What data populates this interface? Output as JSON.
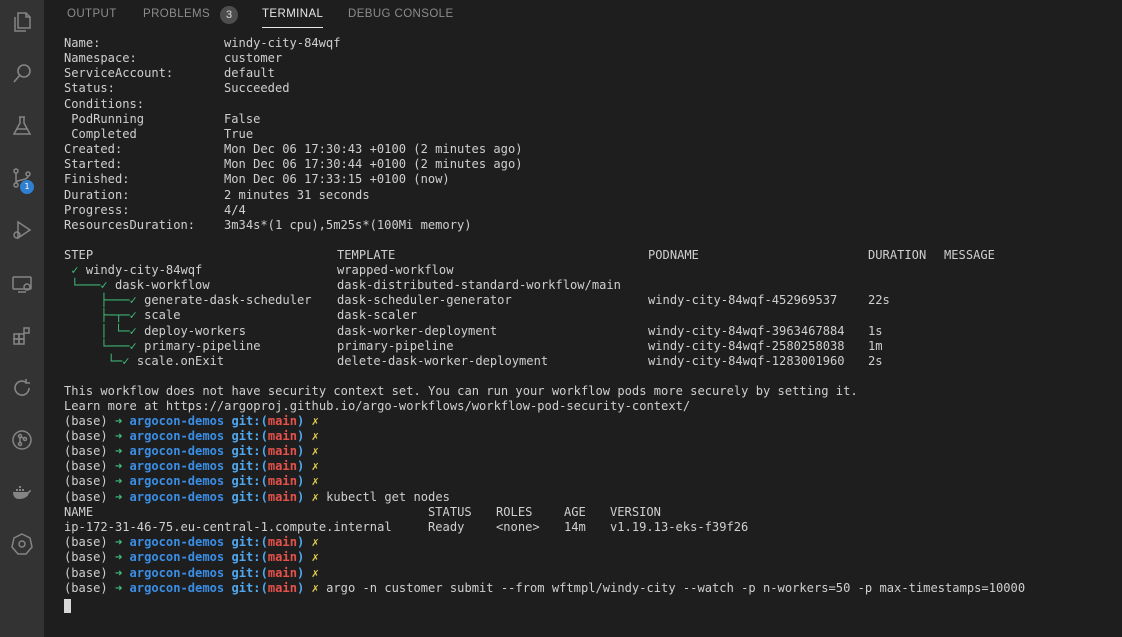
{
  "activity_bar": {
    "icons": [
      "files-icon",
      "search-icon",
      "beaker-icon",
      "source-control-icon",
      "run-debug-icon",
      "remote-explorer-icon",
      "extensions-icon",
      "refresh-icon",
      "git-graph-icon",
      "docker-icon",
      "kubernetes-icon"
    ],
    "badge": "1"
  },
  "panel": {
    "tabs": [
      "OUTPUT",
      "PROBLEMS",
      "TERMINAL",
      "DEBUG CONSOLE"
    ],
    "active_tab": "TERMINAL",
    "problems_count": "3"
  },
  "workflow": {
    "fields": [
      {
        "label": "Name:",
        "value": "windy-city-84wqf"
      },
      {
        "label": "Namespace:",
        "value": "customer"
      },
      {
        "label": "ServiceAccount:",
        "value": "default"
      },
      {
        "label": "Status:",
        "value": "Succeeded"
      },
      {
        "label": "Conditions:",
        "value": ""
      },
      {
        "label": " PodRunning",
        "value": "False"
      },
      {
        "label": " Completed",
        "value": "True"
      },
      {
        "label": "Created:",
        "value": "Mon Dec 06 17:30:43 +0100 (2 minutes ago)"
      },
      {
        "label": "Started:",
        "value": "Mon Dec 06 17:30:44 +0100 (2 minutes ago)"
      },
      {
        "label": "Finished:",
        "value": "Mon Dec 06 17:33:15 +0100 (now)"
      },
      {
        "label": "Duration:",
        "value": "2 minutes 31 seconds"
      },
      {
        "label": "Progress:",
        "value": "4/4"
      },
      {
        "label": "ResourcesDuration:",
        "value": "3m34s*(1 cpu),5m25s*(100Mi memory)"
      }
    ],
    "step_headers": [
      "STEP",
      "TEMPLATE",
      "PODNAME",
      "DURATION",
      "MESSAGE"
    ],
    "steps": [
      {
        "tree": " ✓ ",
        "step": "windy-city-84wqf",
        "template": "wrapped-workflow",
        "pod": "",
        "duration": ""
      },
      {
        "tree": " └───✓ ",
        "step": "dask-workflow",
        "template": "dask-distributed-standard-workflow/main",
        "pod": "",
        "duration": ""
      },
      {
        "tree": "     ├───✓ ",
        "step": "generate-dask-scheduler",
        "template": "dask-scheduler-generator",
        "pod": "windy-city-84wqf-452969537",
        "duration": "22s"
      },
      {
        "tree": "     ├─┬─✓ ",
        "step": "scale",
        "template": "dask-scaler",
        "pod": "",
        "duration": ""
      },
      {
        "tree": "     │ └─✓ ",
        "step": "deploy-workers",
        "template": "dask-worker-deployment",
        "pod": "windy-city-84wqf-3963467884",
        "duration": "1s"
      },
      {
        "tree": "     └───✓ ",
        "step": "primary-pipeline",
        "template": "primary-pipeline",
        "pod": "windy-city-84wqf-2580258038",
        "duration": "1m"
      },
      {
        "tree": "      └─✓ ",
        "step": "scale.onExit",
        "template": "delete-dask-worker-deployment",
        "pod": "windy-city-84wqf-1283001960",
        "duration": "2s"
      }
    ],
    "security_msg_1": "This workflow does not have security context set. You can run your workflow pods more securely by setting it.",
    "security_msg_2": "Learn more at https://argoproj.github.io/argo-workflows/workflow-pod-security-context/"
  },
  "prompt": {
    "env": "(base)",
    "arrow": "➜",
    "dir": "argocon-demos",
    "git": "git:(",
    "branch": "main",
    "git_close": ")",
    "dirty": "✗"
  },
  "commands": {
    "kubectl": "kubectl get nodes",
    "argo": "argo -n customer submit --from wftmpl/windy-city --watch -p n-workers=50 -p max-timestamps=10000"
  },
  "nodes": {
    "headers": [
      "NAME",
      "STATUS",
      "ROLES",
      "AGE",
      "VERSION"
    ],
    "row": [
      "ip-172-31-46-75.eu-central-1.compute.internal",
      "Ready",
      "<none>",
      "14m",
      "v1.19.13-eks-f39f26"
    ]
  }
}
